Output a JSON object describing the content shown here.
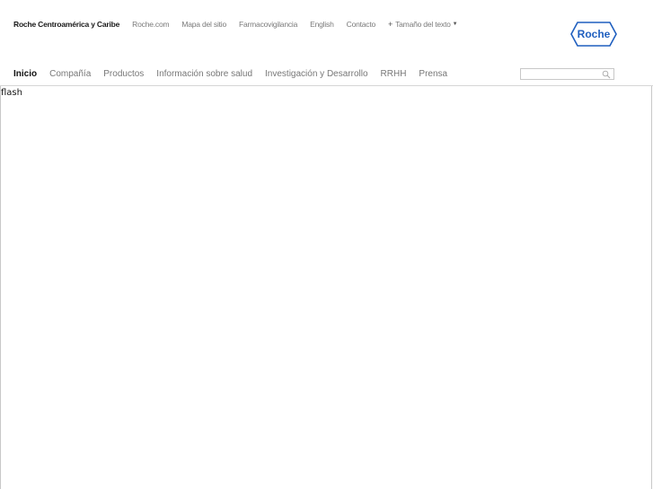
{
  "header": {
    "site_name": "Roche Centroamérica y Caribe",
    "utility_links": [
      "Roche.com",
      "Mapa del sitio",
      "Farmacovigilancia",
      "English",
      "Contacto"
    ],
    "text_size_label": "Tamaño del texto",
    "text_size_icon": "plus-icon",
    "logo_text": "Roche",
    "logo_color": "#1f5fbf"
  },
  "nav": {
    "items": [
      "Inicio",
      "Compañía",
      "Productos",
      "Información sobre salud",
      "Investigación y Desarrollo",
      "RRHH",
      "Prensa"
    ],
    "active": "Inicio"
  },
  "search": {
    "value": "",
    "placeholder": "",
    "icon": "search-icon"
  },
  "content": {
    "flash_label": "flash"
  },
  "colors": {
    "text_dark": "#1a1a1a",
    "text_muted": "#7a7a7a",
    "border": "#c8c8c8",
    "brand_blue": "#1f5fbf"
  }
}
